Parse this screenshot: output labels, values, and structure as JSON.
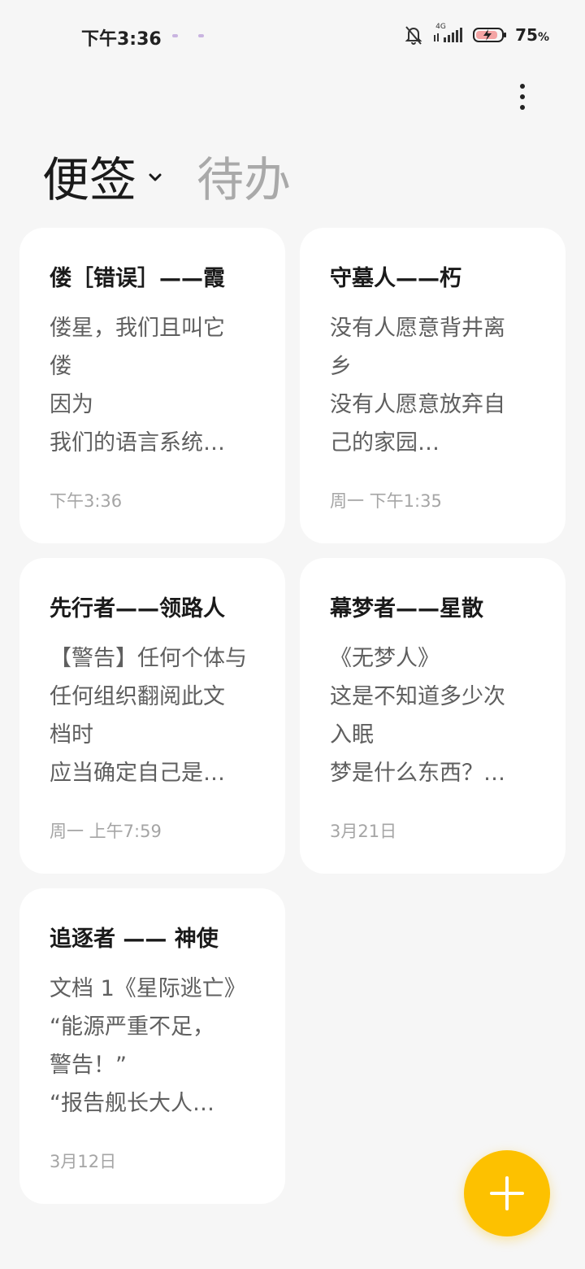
{
  "status_bar": {
    "time": "下午3:36",
    "network": "4G",
    "battery": "75",
    "battery_unit": "%"
  },
  "header": {
    "tab_notes": "便签",
    "tab_todo": "待办"
  },
  "notes": [
    {
      "title": "偻［错误］——霞",
      "body": "偻星，我们且叫它\n偻\n因为\n我们的语言系统…",
      "date": "下午3:36"
    },
    {
      "title": "守墓人——朽",
      "body": "没有人愿意背井离\n乡\n没有人愿意放弃自\n己的家园…",
      "date": "周一 下午1:35"
    },
    {
      "title": "先行者——领路人",
      "body": "【警告】任何个体与\n任何组织翻阅此文\n档时\n应当确定自己是…",
      "date": "周一 上午7:59"
    },
    {
      "title": "幕梦者——星散",
      "body": "《无梦人》\n这是不知道多少次\n入眠\n梦是什么东西？…",
      "date": "3月21日"
    },
    {
      "title": "追逐者 —— 神使",
      "body": "文档 1《星际逃亡》\n“能源严重不足，\n警告！”\n“报告舰长大人…",
      "date": "3月12日"
    }
  ],
  "colors": {
    "background": "#f6f6f6",
    "card": "#ffffff",
    "accent": "#fdc100"
  },
  "icons": [
    "mute-bell-icon",
    "signal-icon",
    "battery-charging-icon",
    "more-vertical-icon",
    "chevron-down-icon",
    "plus-icon"
  ]
}
